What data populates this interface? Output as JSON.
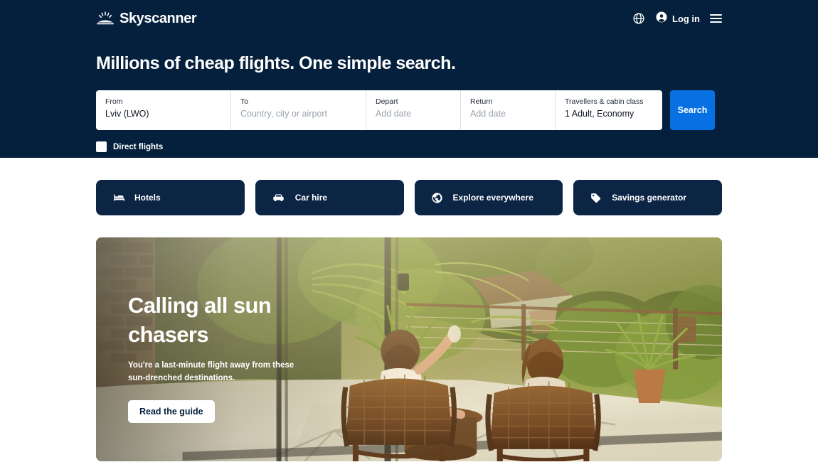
{
  "header": {
    "logo_text": "Skyscanner",
    "logo_icon": "sunrise-icon",
    "nav": {
      "globe_icon": "globe-icon",
      "account_icon": "account-circle-icon",
      "login_label": "Log in",
      "menu_icon": "hamburger-menu-icon"
    },
    "headline": "Millions of cheap flights. One simple search."
  },
  "search": {
    "fields": [
      {
        "label": "From",
        "value": "Lviv (LWO)",
        "is_placeholder": false,
        "name": "from"
      },
      {
        "label": "To",
        "value": "Country, city or airport",
        "is_placeholder": true,
        "name": "to"
      },
      {
        "label": "Depart",
        "value": "Add date",
        "is_placeholder": true,
        "name": "depart"
      },
      {
        "label": "Return",
        "value": "Add date",
        "is_placeholder": true,
        "name": "return"
      },
      {
        "label": "Travellers & cabin class",
        "value": "1 Adult, Economy",
        "is_placeholder": false,
        "name": "travellers"
      }
    ],
    "search_button": "Search",
    "direct_flights_label": "Direct flights",
    "direct_flights_checked": false
  },
  "cards": [
    {
      "label": "Hotels",
      "icon": "bed-icon"
    },
    {
      "label": "Car hire",
      "icon": "car-icon"
    },
    {
      "label": "Explore everywhere",
      "icon": "globe-icon"
    },
    {
      "label": "Savings generator",
      "icon": "tag-icon"
    }
  ],
  "hero": {
    "title": "Calling all sun chasers",
    "subtitle": "You're a last-minute flight away from these sun-drenched destinations.",
    "button_label": "Read the guide",
    "image_alt": "Couple relaxing in wicker chairs on a sunlit terrace overlooking tropical greenery"
  },
  "colors": {
    "header_bg": "#05203c",
    "card_bg": "#0c2545",
    "accent_blue": "#0770e3",
    "white": "#ffffff"
  }
}
